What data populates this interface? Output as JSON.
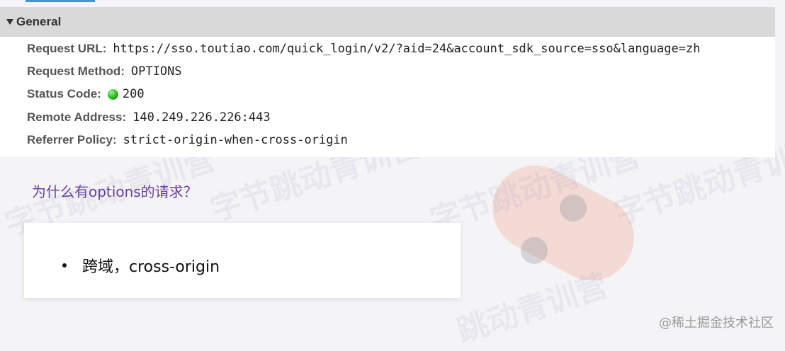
{
  "general": {
    "title": "General",
    "rows": [
      {
        "label": "Request URL:",
        "value": "https://sso.toutiao.com/quick_login/v2/?aid=24&account_sdk_source=sso&language=zh"
      },
      {
        "label": "Request Method:",
        "value": "OPTIONS"
      },
      {
        "label": "Status Code:",
        "value": "200",
        "status_color": "#28b81e"
      },
      {
        "label": "Remote Address:",
        "value": "140.249.226.226:443"
      },
      {
        "label": "Referrer Policy:",
        "value": "strict-origin-when-cross-origin"
      }
    ]
  },
  "question": "为什么有options的请求？",
  "card": {
    "bullets": [
      "跨域，cross-origin"
    ]
  },
  "watermarks": [
    "字节跳动青训营",
    "字节跳动青训营",
    "字节跳动青训营",
    "字节跳动青训营",
    "跳动青训营"
  ],
  "brand_watermark": "@稀土掘金技术社区",
  "colors": {
    "header_bg": "#d9d9d9",
    "question_text": "#6a3fa0",
    "tab_accent": "#4a90d9"
  }
}
